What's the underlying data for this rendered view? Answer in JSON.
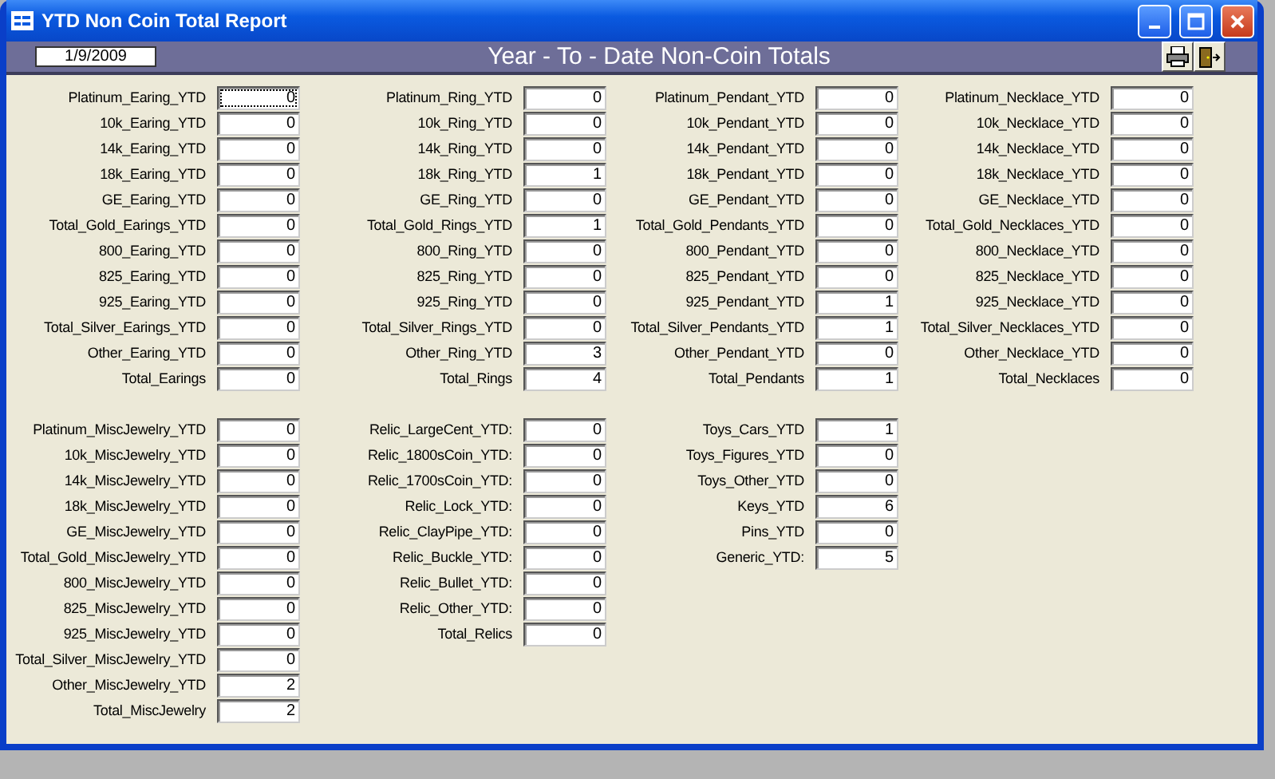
{
  "window": {
    "title": "YTD Non Coin Total Report"
  },
  "header": {
    "date": "1/9/2009",
    "title": "Year - To - Date Non-Coin Totals"
  },
  "top_groups": [
    {
      "fields": [
        {
          "label": "Platinum_Earing_YTD",
          "value": "0",
          "focused": true
        },
        {
          "label": "10k_Earing_YTD",
          "value": "0",
          "focused": false
        },
        {
          "label": "14k_Earing_YTD",
          "value": "0",
          "focused": false
        },
        {
          "label": "18k_Earing_YTD",
          "value": "0",
          "focused": false
        },
        {
          "label": "GE_Earing_YTD",
          "value": "0",
          "focused": false
        },
        {
          "label": "Total_Gold_Earings_YTD",
          "value": "0",
          "focused": false
        },
        {
          "label": "800_Earing_YTD",
          "value": "0",
          "focused": false
        },
        {
          "label": "825_Earing_YTD",
          "value": "0",
          "focused": false
        },
        {
          "label": "925_Earing_YTD",
          "value": "0",
          "focused": false
        },
        {
          "label": "Total_Silver_Earings_YTD",
          "value": "0",
          "focused": false
        },
        {
          "label": "Other_Earing_YTD",
          "value": "0",
          "focused": false
        },
        {
          "label": "Total_Earings",
          "value": "0",
          "focused": false
        }
      ]
    },
    {
      "fields": [
        {
          "label": "Platinum_Ring_YTD",
          "value": "0",
          "focused": false
        },
        {
          "label": "10k_Ring_YTD",
          "value": "0",
          "focused": false
        },
        {
          "label": "14k_Ring_YTD",
          "value": "0",
          "focused": false
        },
        {
          "label": "18k_Ring_YTD",
          "value": "1",
          "focused": false
        },
        {
          "label": "GE_Ring_YTD",
          "value": "0",
          "focused": false
        },
        {
          "label": "Total_Gold_Rings_YTD",
          "value": "1",
          "focused": false
        },
        {
          "label": "800_Ring_YTD",
          "value": "0",
          "focused": false
        },
        {
          "label": "825_Ring_YTD",
          "value": "0",
          "focused": false
        },
        {
          "label": "925_Ring_YTD",
          "value": "0",
          "focused": false
        },
        {
          "label": "Total_Silver_Rings_YTD",
          "value": "0",
          "focused": false
        },
        {
          "label": "Other_Ring_YTD",
          "value": "3",
          "focused": false
        },
        {
          "label": "Total_Rings",
          "value": "4",
          "focused": false
        }
      ]
    },
    {
      "fields": [
        {
          "label": "Platinum_Pendant_YTD",
          "value": "0",
          "focused": false
        },
        {
          "label": "10k_Pendant_YTD",
          "value": "0",
          "focused": false
        },
        {
          "label": "14k_Pendant_YTD",
          "value": "0",
          "focused": false
        },
        {
          "label": "18k_Pendant_YTD",
          "value": "0",
          "focused": false
        },
        {
          "label": "GE_Pendant_YTD",
          "value": "0",
          "focused": false
        },
        {
          "label": "Total_Gold_Pendants_YTD",
          "value": "0",
          "focused": false
        },
        {
          "label": "800_Pendant_YTD",
          "value": "0",
          "focused": false
        },
        {
          "label": "825_Pendant_YTD",
          "value": "0",
          "focused": false
        },
        {
          "label": "925_Pendant_YTD",
          "value": "1",
          "focused": false
        },
        {
          "label": "Total_Silver_Pendants_YTD",
          "value": "1",
          "focused": false
        },
        {
          "label": "Other_Pendant_YTD",
          "value": "0",
          "focused": false
        },
        {
          "label": "Total_Pendants",
          "value": "1",
          "focused": false
        }
      ]
    },
    {
      "fields": [
        {
          "label": "Platinum_Necklace_YTD",
          "value": "0",
          "focused": false
        },
        {
          "label": "10k_Necklace_YTD",
          "value": "0",
          "focused": false
        },
        {
          "label": "14k_Necklace_YTD",
          "value": "0",
          "focused": false
        },
        {
          "label": "18k_Necklace_YTD",
          "value": "0",
          "focused": false
        },
        {
          "label": "GE_Necklace_YTD",
          "value": "0",
          "focused": false
        },
        {
          "label": "Total_Gold_Necklaces_YTD",
          "value": "0",
          "focused": false
        },
        {
          "label": "800_Necklace_YTD",
          "value": "0",
          "focused": false
        },
        {
          "label": "825_Necklace_YTD",
          "value": "0",
          "focused": false
        },
        {
          "label": "925_Necklace_YTD",
          "value": "0",
          "focused": false
        },
        {
          "label": "Total_Silver_Necklaces_YTD",
          "value": "0",
          "focused": false
        },
        {
          "label": "Other_Necklace_YTD",
          "value": "0",
          "focused": false
        },
        {
          "label": "Total_Necklaces",
          "value": "0",
          "focused": false
        }
      ]
    }
  ],
  "bottom_groups": [
    {
      "fields": [
        {
          "label": "Platinum_MiscJewelry_YTD",
          "value": "0",
          "focused": false
        },
        {
          "label": "10k_MiscJewelry_YTD",
          "value": "0",
          "focused": false
        },
        {
          "label": "14k_MiscJewelry_YTD",
          "value": "0",
          "focused": false
        },
        {
          "label": "18k_MiscJewelry_YTD",
          "value": "0",
          "focused": false
        },
        {
          "label": "GE_MiscJewelry_YTD",
          "value": "0",
          "focused": false
        },
        {
          "label": "Total_Gold_MiscJewelry_YTD",
          "value": "0",
          "focused": false
        },
        {
          "label": "800_MiscJewelry_YTD",
          "value": "0",
          "focused": false
        },
        {
          "label": "825_MiscJewelry_YTD",
          "value": "0",
          "focused": false
        },
        {
          "label": "925_MiscJewelry_YTD",
          "value": "0",
          "focused": false
        },
        {
          "label": "Total_Silver_MiscJewelry_YTD",
          "value": "0",
          "focused": false
        },
        {
          "label": "Other_MiscJewelry_YTD",
          "value": "2",
          "focused": false
        },
        {
          "label": "Total_MiscJewelry",
          "value": "2",
          "focused": false
        }
      ]
    },
    {
      "fields": [
        {
          "label": "Relic_LargeCent_YTD:",
          "value": "0",
          "focused": false
        },
        {
          "label": "Relic_1800sCoin_YTD:",
          "value": "0",
          "focused": false
        },
        {
          "label": "Relic_1700sCoin_YTD:",
          "value": "0",
          "focused": false
        },
        {
          "label": "Relic_Lock_YTD:",
          "value": "0",
          "focused": false
        },
        {
          "label": "Relic_ClayPipe_YTD:",
          "value": "0",
          "focused": false
        },
        {
          "label": "Relic_Buckle_YTD:",
          "value": "0",
          "focused": false
        },
        {
          "label": "Relic_Bullet_YTD:",
          "value": "0",
          "focused": false
        },
        {
          "label": "Relic_Other_YTD:",
          "value": "0",
          "focused": false
        },
        {
          "label": "Total_Relics",
          "value": "0",
          "focused": false
        }
      ]
    },
    {
      "fields": [
        {
          "label": "Toys_Cars_YTD",
          "value": "1",
          "focused": false
        },
        {
          "label": "Toys_Figures_YTD",
          "value": "0",
          "focused": false
        },
        {
          "label": "Toys_Other_YTD",
          "value": "0",
          "focused": false
        },
        {
          "label": "Keys_YTD",
          "value": "6",
          "focused": false
        },
        {
          "label": "Pins_YTD",
          "value": "0",
          "focused": false
        },
        {
          "label": "Generic_YTD:",
          "value": "5",
          "focused": false
        }
      ]
    }
  ]
}
